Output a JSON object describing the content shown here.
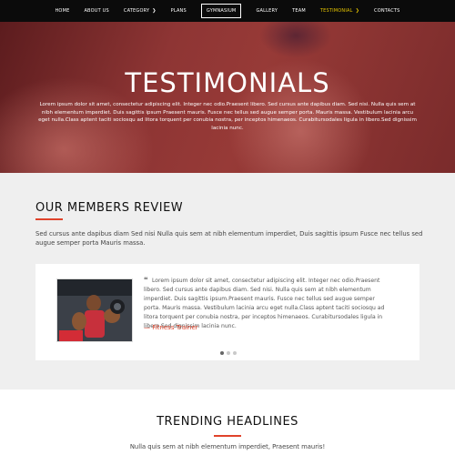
{
  "nav": {
    "items": [
      {
        "label": "HOME"
      },
      {
        "label": "ABOUT US"
      },
      {
        "label": "CATEGORY"
      },
      {
        "label": "PLANS"
      },
      {
        "label": "GYMNASIUM"
      },
      {
        "label": "GALLERY"
      },
      {
        "label": "TEAM"
      },
      {
        "label": "TESTIMONIAL"
      },
      {
        "label": "CONTACTS"
      }
    ],
    "active_color": "#e5c400"
  },
  "hero": {
    "title": "TESTIMONIALS",
    "text": "Lorem ipsum dolor sit amet, consectetur adipiscing elit. Integer nec odio.Praesent libero. Sed cursus ante dapibus diam. Sed nisi. Nulla quis sem at nibh elementum imperdiet. Duis sagittis ipsum Praesent mauris. Fusce nec tellus sed augue semper porta. Mauris massa. Vestibulum lacinia arcu eget nulla.Class aptent taciti sociosqu ad litora torquent per conubia nostra, per inceptos himenaeos. Curabitursodales ligula in libero.Sed dignissim lacinia nunc."
  },
  "members": {
    "title": "OUR MEMBERS REVIEW",
    "description": "Sed cursus ante dapibus diam Sed nisi Nulla quis sem at nibh elementum imperdiet, Duis sagittis ipsum Fusce nec tellus sed augue semper porta Mauris massa.",
    "review": {
      "quote_icon": "quote-icon",
      "text": "Lorem ipsum dolor sit amet, consectetur adipiscing elit. Integer nec odio.Praesent libero. Sed cursus ante dapibus diam. Sed nisi. Nulla quis sem at nibh elementum imperdiet. Duis sagittis ipsum.Praesent mauris. Fusce nec tellus sed augue semper porta. Mauris massa. Vestibulum lacinia arcu eget nulla.Class aptent taciti sociosqu ad litora torquent per conubia nostra, per inceptos himenaeos. Curabitursodales ligula in libero.Sed dignissim lacinia nunc.",
      "author": "— Fitness Trainer"
    },
    "slider": {
      "count": 3,
      "active": 1
    }
  },
  "trending": {
    "title": "TRENDING HEADLINES",
    "description": "Nulla quis sem at nibh elementum imperdiet, Praesent mauris!"
  },
  "colors": {
    "accent": "#e0432b",
    "nav_bg": "#0b0b0b",
    "hero_bg": "#8e3534",
    "section_bg": "#efefef"
  }
}
